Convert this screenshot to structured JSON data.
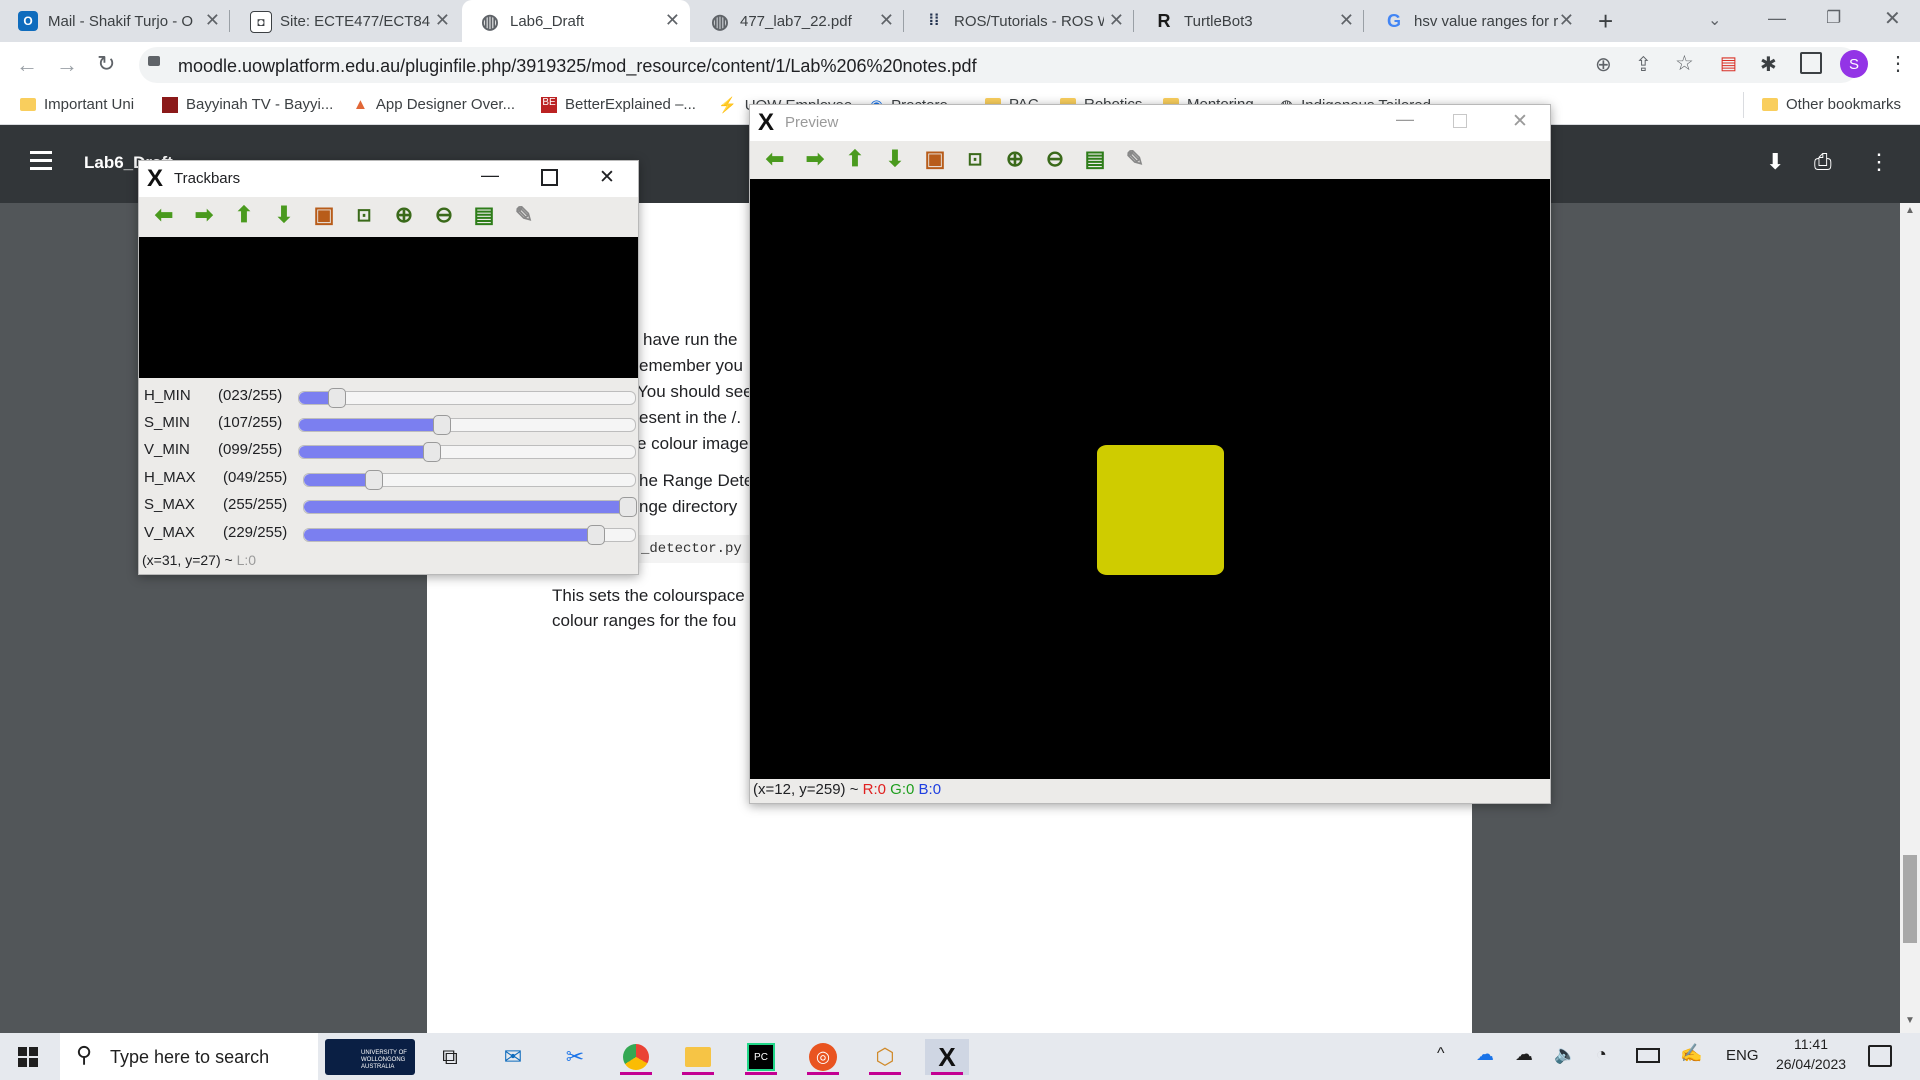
{
  "tabs": [
    {
      "title": "Mail - Shakif Turjo - O",
      "icon": "outlook-icon",
      "color": "#0f6cbd",
      "glyph": "O"
    },
    {
      "title": "Site: ECTE477/ECT847",
      "icon": "shield-icon",
      "color": "#3c4043",
      "glyph": "◘"
    },
    {
      "title": "Lab6_Draft",
      "icon": "globe-icon",
      "color": "#5f6368",
      "glyph": "◍"
    },
    {
      "title": "477_lab7_22.pdf",
      "icon": "globe-icon",
      "color": "#5f6368",
      "glyph": "◍"
    },
    {
      "title": "ROS/Tutorials - ROS W",
      "icon": "ros-icon",
      "color": "#22314e",
      "glyph": "⁞⁞"
    },
    {
      "title": "TurtleBot3",
      "icon": "robotis-icon",
      "color": "#1a1a1a",
      "glyph": "R"
    },
    {
      "title": "hsv value ranges for r",
      "icon": "google-icon",
      "color": "#4285f4",
      "glyph": "G"
    }
  ],
  "new_tab": "+",
  "url": "moodle.uowplatform.edu.au/pluginfile.php/3919325/mod_resource/content/1/Lab%206%20notes.pdf",
  "profile_initial": "S",
  "bookmarks": [
    "Important Uni",
    "Bayyinah TV - Bayyi...",
    "App Designer Over...",
    "BetterExplained –...",
    "UOW Employee...",
    "Proctoro",
    "PAC",
    "Robotics",
    "Mentoring",
    "Indigenous Tailored..."
  ],
  "other_bookmarks": "Other bookmarks",
  "pdf": {
    "title": "Lab6_Draft",
    "lines": [
      "have run the",
      "emember you",
      "You should see",
      "esent in the /.",
      "e colour image",
      "he Range Dete",
      "nge directory",
      "_detector.py",
      "This sets the colourspace",
      "colour ranges for the fou"
    ]
  },
  "trackbars_window": {
    "title": "Trackbars",
    "sliders": [
      {
        "label": "H_MIN",
        "value": "(023/255)",
        "level": 23
      },
      {
        "label": "S_MIN",
        "value": "(107/255)",
        "level": 107
      },
      {
        "label": "V_MIN",
        "value": "(099/255)",
        "level": 99
      },
      {
        "label": "H_MAX",
        "value": "(049/255)",
        "level": 49
      },
      {
        "label": "S_MAX",
        "value": "(255/255)",
        "level": 255
      },
      {
        "label": "V_MAX",
        "value": "(229/255)",
        "level": 229
      }
    ],
    "status_coords": "(x=31, y=27) ~",
    "status_channel": "L:0"
  },
  "preview_window": {
    "title": "Preview",
    "status_coords": "(x=12, y=259) ~",
    "r": "R:0",
    "g": "G:0",
    "b": "B:0",
    "object_color": "#cfcc00"
  },
  "taskbar": {
    "search_placeholder": "Type here to search",
    "uow_logo_text": "UNIVERSITY OF WOLLONGONG AUSTRALIA",
    "language": "ENG",
    "time": "11:41",
    "date": "26/04/2023"
  }
}
